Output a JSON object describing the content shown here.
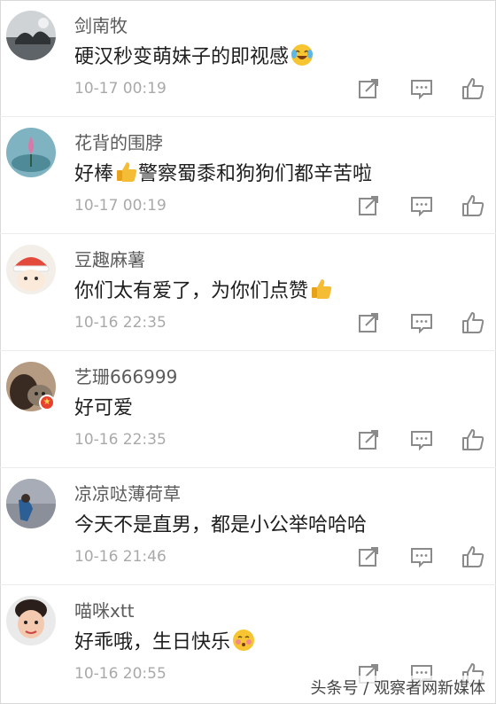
{
  "comments": [
    {
      "username": "剑南牧",
      "text": "硬汉秒变萌妹子的即视感",
      "emoji": "laughing-tears-emoji",
      "time": "10-17 00:19"
    },
    {
      "username": "花背的围脖",
      "text_before": "好棒",
      "emoji": "thumbs-up-emoji",
      "text_after": "警察蜀黍和狗狗们都辛苦啦",
      "time": "10-17 00:19"
    },
    {
      "username": "豆趣麻薯",
      "text": "你们太有爱了，为你们点赞",
      "emoji": "thumbs-up-emoji",
      "time": "10-16 22:35"
    },
    {
      "username": "艺珊666999",
      "text": "好可爱",
      "time": "10-16 22:35",
      "verified_badge": "star-badge"
    },
    {
      "username": "凉凉哒薄荷草",
      "text": "今天不是直男，都是小公举哈哈哈",
      "time": "10-16 21:46"
    },
    {
      "username": "喵咪xtt",
      "text": "好乖哦，生日快乐",
      "emoji": "blushing-kiss-emoji",
      "time": "10-16 20:55"
    }
  ],
  "watermark": "头条号 / 观察者网新媒体",
  "icons": {
    "repost": "repost-icon",
    "reply": "comment-icon",
    "like": "like-icon"
  },
  "colors": {
    "username": "#5b5b5b",
    "text": "#1e1e1e",
    "time": "#a9a9a9",
    "icon": "#8a8a8a",
    "badge": "#e8412f"
  }
}
